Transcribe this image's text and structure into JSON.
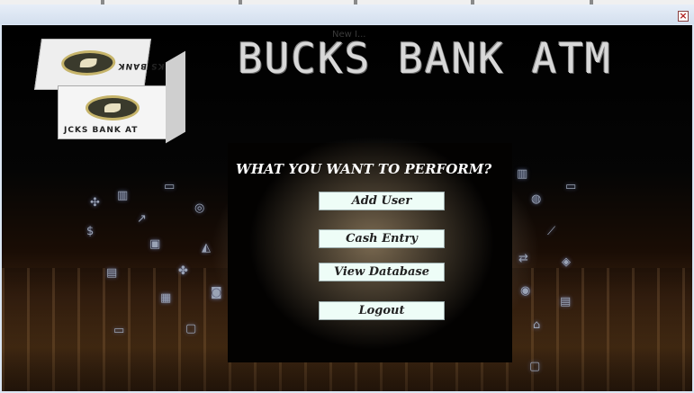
{
  "window": {
    "faint_title": "New I...",
    "close_glyph": "×"
  },
  "header": {
    "bank_title": "BUCKS BANK ATM"
  },
  "logo": {
    "cube_text_top": "JCKS BANK",
    "cube_text_front": "JCKS BANK AT"
  },
  "menu": {
    "question": "WHAT YOU WANT TO PERFORM?",
    "buttons": {
      "add_user": "Add User",
      "cash_entry": "Cash Entry",
      "view_database": "View Database",
      "logout": "Logout"
    }
  },
  "icons": {
    "close": "close-icon",
    "logo": "bank-logo-cube"
  }
}
